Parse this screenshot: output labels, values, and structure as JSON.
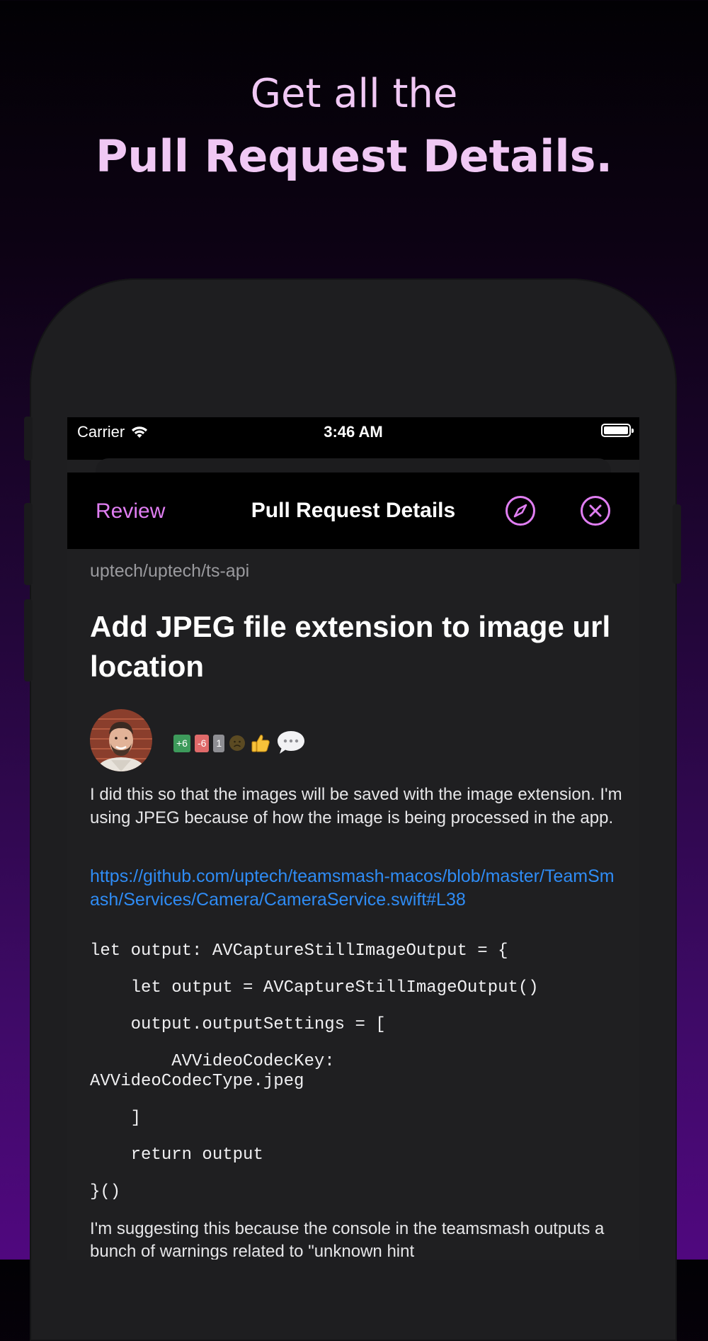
{
  "headline": {
    "line1": "Get all the",
    "line2": "Pull Request Details."
  },
  "status_bar": {
    "carrier": "Carrier",
    "time": "3:46 AM"
  },
  "nav": {
    "back_label": "Review",
    "title": "Pull Request Details",
    "accent_color": "#e07ef2"
  },
  "pr": {
    "repo": "uptech/uptech/ts-api",
    "title": "Add JPEG file extension to image url location",
    "stats": {
      "additions": "+6",
      "deletions": "-6",
      "files": "1"
    },
    "description": "I did this so that the images will be saved with the image extension. I'm using JPEG because of how the image is being processed in the app.",
    "link": "https://github.com/uptech/teamsmash-macos/blob/master/TeamSmash/Services/Camera/CameraService.swift#L38",
    "code_lines": [
      "let output: AVCaptureStillImageOutput = {",
      "    let output = AVCaptureStillImageOutput()",
      "    output.outputSettings = [",
      "        AVVideoCodecKey:\nAVVideoCodecType.jpeg",
      "    ]",
      "    return output",
      "}()"
    ],
    "followup": "I'm suggesting this because the console in the teamsmash outputs a bunch of warnings related to \"unknown hint"
  }
}
